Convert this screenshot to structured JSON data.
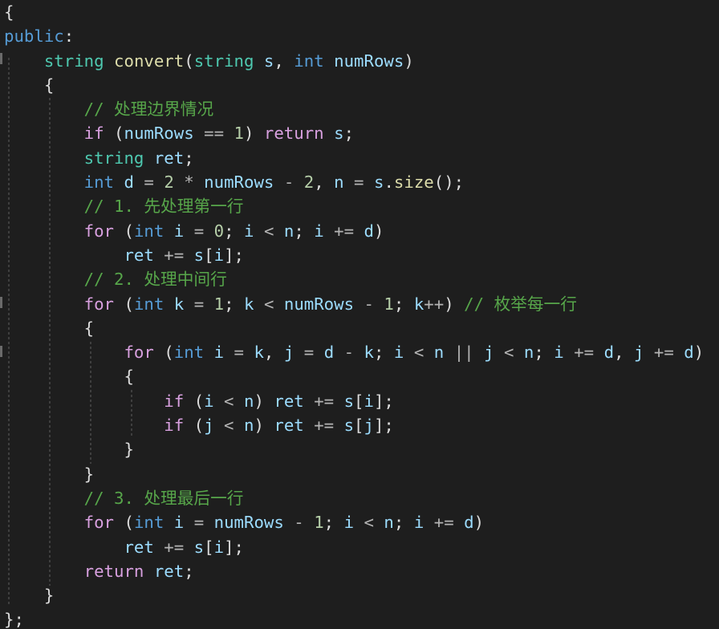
{
  "editor": {
    "language": "C++",
    "theme": {
      "background": "#1e1e1e",
      "keyword": "#569cd6",
      "control": "#d8a0df",
      "type": "#4ec9b0",
      "function": "#dcdcaa",
      "parameter": "#9cdcfe",
      "variable": "#9cdcfe",
      "number": "#b5cea8",
      "comment": "#57a64a",
      "punctuation": "#dcdcdc",
      "operator": "#b4b4b4"
    },
    "lines": [
      [
        {
          "t": "{",
          "k": "punct"
        }
      ],
      [
        {
          "t": "public",
          "k": "keyword"
        },
        {
          "t": ":",
          "k": "punct"
        }
      ],
      [
        {
          "t": "    ",
          "k": "plain"
        },
        {
          "t": "string",
          "k": "type"
        },
        {
          "t": " ",
          "k": "plain"
        },
        {
          "t": "convert",
          "k": "func"
        },
        {
          "t": "(",
          "k": "punct"
        },
        {
          "t": "string",
          "k": "type"
        },
        {
          "t": " ",
          "k": "plain"
        },
        {
          "t": "s",
          "k": "param"
        },
        {
          "t": ", ",
          "k": "punct"
        },
        {
          "t": "int",
          "k": "keyword"
        },
        {
          "t": " ",
          "k": "plain"
        },
        {
          "t": "numRows",
          "k": "param"
        },
        {
          "t": ")",
          "k": "punct"
        }
      ],
      [
        {
          "t": "    {",
          "k": "punct"
        }
      ],
      [
        {
          "t": "        ",
          "k": "plain"
        },
        {
          "t": "// 处理边界情况",
          "k": "comment"
        }
      ],
      [
        {
          "t": "        ",
          "k": "plain"
        },
        {
          "t": "if",
          "k": "control"
        },
        {
          "t": " (",
          "k": "punct"
        },
        {
          "t": "numRows",
          "k": "param"
        },
        {
          "t": " == ",
          "k": "operator"
        },
        {
          "t": "1",
          "k": "number"
        },
        {
          "t": ") ",
          "k": "punct"
        },
        {
          "t": "return",
          "k": "control"
        },
        {
          "t": " ",
          "k": "plain"
        },
        {
          "t": "s",
          "k": "param"
        },
        {
          "t": ";",
          "k": "punct"
        }
      ],
      [
        {
          "t": "        ",
          "k": "plain"
        },
        {
          "t": "string",
          "k": "type"
        },
        {
          "t": " ",
          "k": "plain"
        },
        {
          "t": "ret",
          "k": "var"
        },
        {
          "t": ";",
          "k": "punct"
        }
      ],
      [
        {
          "t": "        ",
          "k": "plain"
        },
        {
          "t": "int",
          "k": "keyword"
        },
        {
          "t": " ",
          "k": "plain"
        },
        {
          "t": "d",
          "k": "var"
        },
        {
          "t": " = ",
          "k": "operator"
        },
        {
          "t": "2",
          "k": "number"
        },
        {
          "t": " * ",
          "k": "operator"
        },
        {
          "t": "numRows",
          "k": "param"
        },
        {
          "t": " - ",
          "k": "operator"
        },
        {
          "t": "2",
          "k": "number"
        },
        {
          "t": ", ",
          "k": "punct"
        },
        {
          "t": "n",
          "k": "var"
        },
        {
          "t": " = ",
          "k": "operator"
        },
        {
          "t": "s",
          "k": "param"
        },
        {
          "t": ".",
          "k": "punct"
        },
        {
          "t": "size",
          "k": "func"
        },
        {
          "t": "();",
          "k": "punct"
        }
      ],
      [
        {
          "t": "        ",
          "k": "plain"
        },
        {
          "t": "// 1. 先处理第一行",
          "k": "comment"
        }
      ],
      [
        {
          "t": "        ",
          "k": "plain"
        },
        {
          "t": "for",
          "k": "control"
        },
        {
          "t": " (",
          "k": "punct"
        },
        {
          "t": "int",
          "k": "keyword"
        },
        {
          "t": " ",
          "k": "plain"
        },
        {
          "t": "i",
          "k": "var"
        },
        {
          "t": " = ",
          "k": "operator"
        },
        {
          "t": "0",
          "k": "number"
        },
        {
          "t": "; ",
          "k": "punct"
        },
        {
          "t": "i",
          "k": "var"
        },
        {
          "t": " < ",
          "k": "operator"
        },
        {
          "t": "n",
          "k": "var"
        },
        {
          "t": "; ",
          "k": "punct"
        },
        {
          "t": "i",
          "k": "var"
        },
        {
          "t": " += ",
          "k": "operator"
        },
        {
          "t": "d",
          "k": "var"
        },
        {
          "t": ")",
          "k": "punct"
        }
      ],
      [
        {
          "t": "            ",
          "k": "plain"
        },
        {
          "t": "ret",
          "k": "var"
        },
        {
          "t": " += ",
          "k": "operator"
        },
        {
          "t": "s",
          "k": "param"
        },
        {
          "t": "[",
          "k": "punct"
        },
        {
          "t": "i",
          "k": "var"
        },
        {
          "t": "];",
          "k": "punct"
        }
      ],
      [
        {
          "t": "        ",
          "k": "plain"
        },
        {
          "t": "// 2. 处理中间行",
          "k": "comment"
        }
      ],
      [
        {
          "t": "        ",
          "k": "plain"
        },
        {
          "t": "for",
          "k": "control"
        },
        {
          "t": " (",
          "k": "punct"
        },
        {
          "t": "int",
          "k": "keyword"
        },
        {
          "t": " ",
          "k": "plain"
        },
        {
          "t": "k",
          "k": "var"
        },
        {
          "t": " = ",
          "k": "operator"
        },
        {
          "t": "1",
          "k": "number"
        },
        {
          "t": "; ",
          "k": "punct"
        },
        {
          "t": "k",
          "k": "var"
        },
        {
          "t": " < ",
          "k": "operator"
        },
        {
          "t": "numRows",
          "k": "param"
        },
        {
          "t": " - ",
          "k": "operator"
        },
        {
          "t": "1",
          "k": "number"
        },
        {
          "t": "; ",
          "k": "punct"
        },
        {
          "t": "k",
          "k": "var"
        },
        {
          "t": "++",
          "k": "operator"
        },
        {
          "t": ") ",
          "k": "punct"
        },
        {
          "t": "// 枚举每一行",
          "k": "comment"
        }
      ],
      [
        {
          "t": "        {",
          "k": "punct"
        }
      ],
      [
        {
          "t": "            ",
          "k": "plain"
        },
        {
          "t": "for",
          "k": "control"
        },
        {
          "t": " (",
          "k": "punct"
        },
        {
          "t": "int",
          "k": "keyword"
        },
        {
          "t": " ",
          "k": "plain"
        },
        {
          "t": "i",
          "k": "var"
        },
        {
          "t": " = ",
          "k": "operator"
        },
        {
          "t": "k",
          "k": "var"
        },
        {
          "t": ", ",
          "k": "punct"
        },
        {
          "t": "j",
          "k": "var"
        },
        {
          "t": " = ",
          "k": "operator"
        },
        {
          "t": "d",
          "k": "var"
        },
        {
          "t": " - ",
          "k": "operator"
        },
        {
          "t": "k",
          "k": "var"
        },
        {
          "t": "; ",
          "k": "punct"
        },
        {
          "t": "i",
          "k": "var"
        },
        {
          "t": " < ",
          "k": "operator"
        },
        {
          "t": "n",
          "k": "var"
        },
        {
          "t": " || ",
          "k": "operator"
        },
        {
          "t": "j",
          "k": "var"
        },
        {
          "t": " < ",
          "k": "operator"
        },
        {
          "t": "n",
          "k": "var"
        },
        {
          "t": "; ",
          "k": "punct"
        },
        {
          "t": "i",
          "k": "var"
        },
        {
          "t": " += ",
          "k": "operator"
        },
        {
          "t": "d",
          "k": "var"
        },
        {
          "t": ", ",
          "k": "punct"
        },
        {
          "t": "j",
          "k": "var"
        },
        {
          "t": " += ",
          "k": "operator"
        },
        {
          "t": "d",
          "k": "var"
        },
        {
          "t": ")",
          "k": "punct"
        }
      ],
      [
        {
          "t": "            {",
          "k": "punct"
        }
      ],
      [
        {
          "t": "                ",
          "k": "plain"
        },
        {
          "t": "if",
          "k": "control"
        },
        {
          "t": " (",
          "k": "punct"
        },
        {
          "t": "i",
          "k": "var"
        },
        {
          "t": " < ",
          "k": "operator"
        },
        {
          "t": "n",
          "k": "var"
        },
        {
          "t": ") ",
          "k": "punct"
        },
        {
          "t": "ret",
          "k": "var"
        },
        {
          "t": " += ",
          "k": "operator"
        },
        {
          "t": "s",
          "k": "param"
        },
        {
          "t": "[",
          "k": "punct"
        },
        {
          "t": "i",
          "k": "var"
        },
        {
          "t": "];",
          "k": "punct"
        }
      ],
      [
        {
          "t": "                ",
          "k": "plain"
        },
        {
          "t": "if",
          "k": "control"
        },
        {
          "t": " (",
          "k": "punct"
        },
        {
          "t": "j",
          "k": "var"
        },
        {
          "t": " < ",
          "k": "operator"
        },
        {
          "t": "n",
          "k": "var"
        },
        {
          "t": ") ",
          "k": "punct"
        },
        {
          "t": "ret",
          "k": "var"
        },
        {
          "t": " += ",
          "k": "operator"
        },
        {
          "t": "s",
          "k": "param"
        },
        {
          "t": "[",
          "k": "punct"
        },
        {
          "t": "j",
          "k": "var"
        },
        {
          "t": "];",
          "k": "punct"
        }
      ],
      [
        {
          "t": "            }",
          "k": "punct"
        }
      ],
      [
        {
          "t": "        }",
          "k": "punct"
        }
      ],
      [
        {
          "t": "        ",
          "k": "plain"
        },
        {
          "t": "// 3. 处理最后一行",
          "k": "comment"
        }
      ],
      [
        {
          "t": "        ",
          "k": "plain"
        },
        {
          "t": "for",
          "k": "control"
        },
        {
          "t": " (",
          "k": "punct"
        },
        {
          "t": "int",
          "k": "keyword"
        },
        {
          "t": " ",
          "k": "plain"
        },
        {
          "t": "i",
          "k": "var"
        },
        {
          "t": " = ",
          "k": "operator"
        },
        {
          "t": "numRows",
          "k": "param"
        },
        {
          "t": " - ",
          "k": "operator"
        },
        {
          "t": "1",
          "k": "number"
        },
        {
          "t": "; ",
          "k": "punct"
        },
        {
          "t": "i",
          "k": "var"
        },
        {
          "t": " < ",
          "k": "operator"
        },
        {
          "t": "n",
          "k": "var"
        },
        {
          "t": "; ",
          "k": "punct"
        },
        {
          "t": "i",
          "k": "var"
        },
        {
          "t": " += ",
          "k": "operator"
        },
        {
          "t": "d",
          "k": "var"
        },
        {
          "t": ")",
          "k": "punct"
        }
      ],
      [
        {
          "t": "            ",
          "k": "plain"
        },
        {
          "t": "ret",
          "k": "var"
        },
        {
          "t": " += ",
          "k": "operator"
        },
        {
          "t": "s",
          "k": "param"
        },
        {
          "t": "[",
          "k": "punct"
        },
        {
          "t": "i",
          "k": "var"
        },
        {
          "t": "];",
          "k": "punct"
        }
      ],
      [
        {
          "t": "        ",
          "k": "plain"
        },
        {
          "t": "return",
          "k": "control"
        },
        {
          "t": " ",
          "k": "plain"
        },
        {
          "t": "ret",
          "k": "var"
        },
        {
          "t": ";",
          "k": "punct"
        }
      ],
      [
        {
          "t": "    }",
          "k": "punct"
        }
      ],
      [
        {
          "t": "};",
          "k": "punct"
        }
      ]
    ]
  }
}
